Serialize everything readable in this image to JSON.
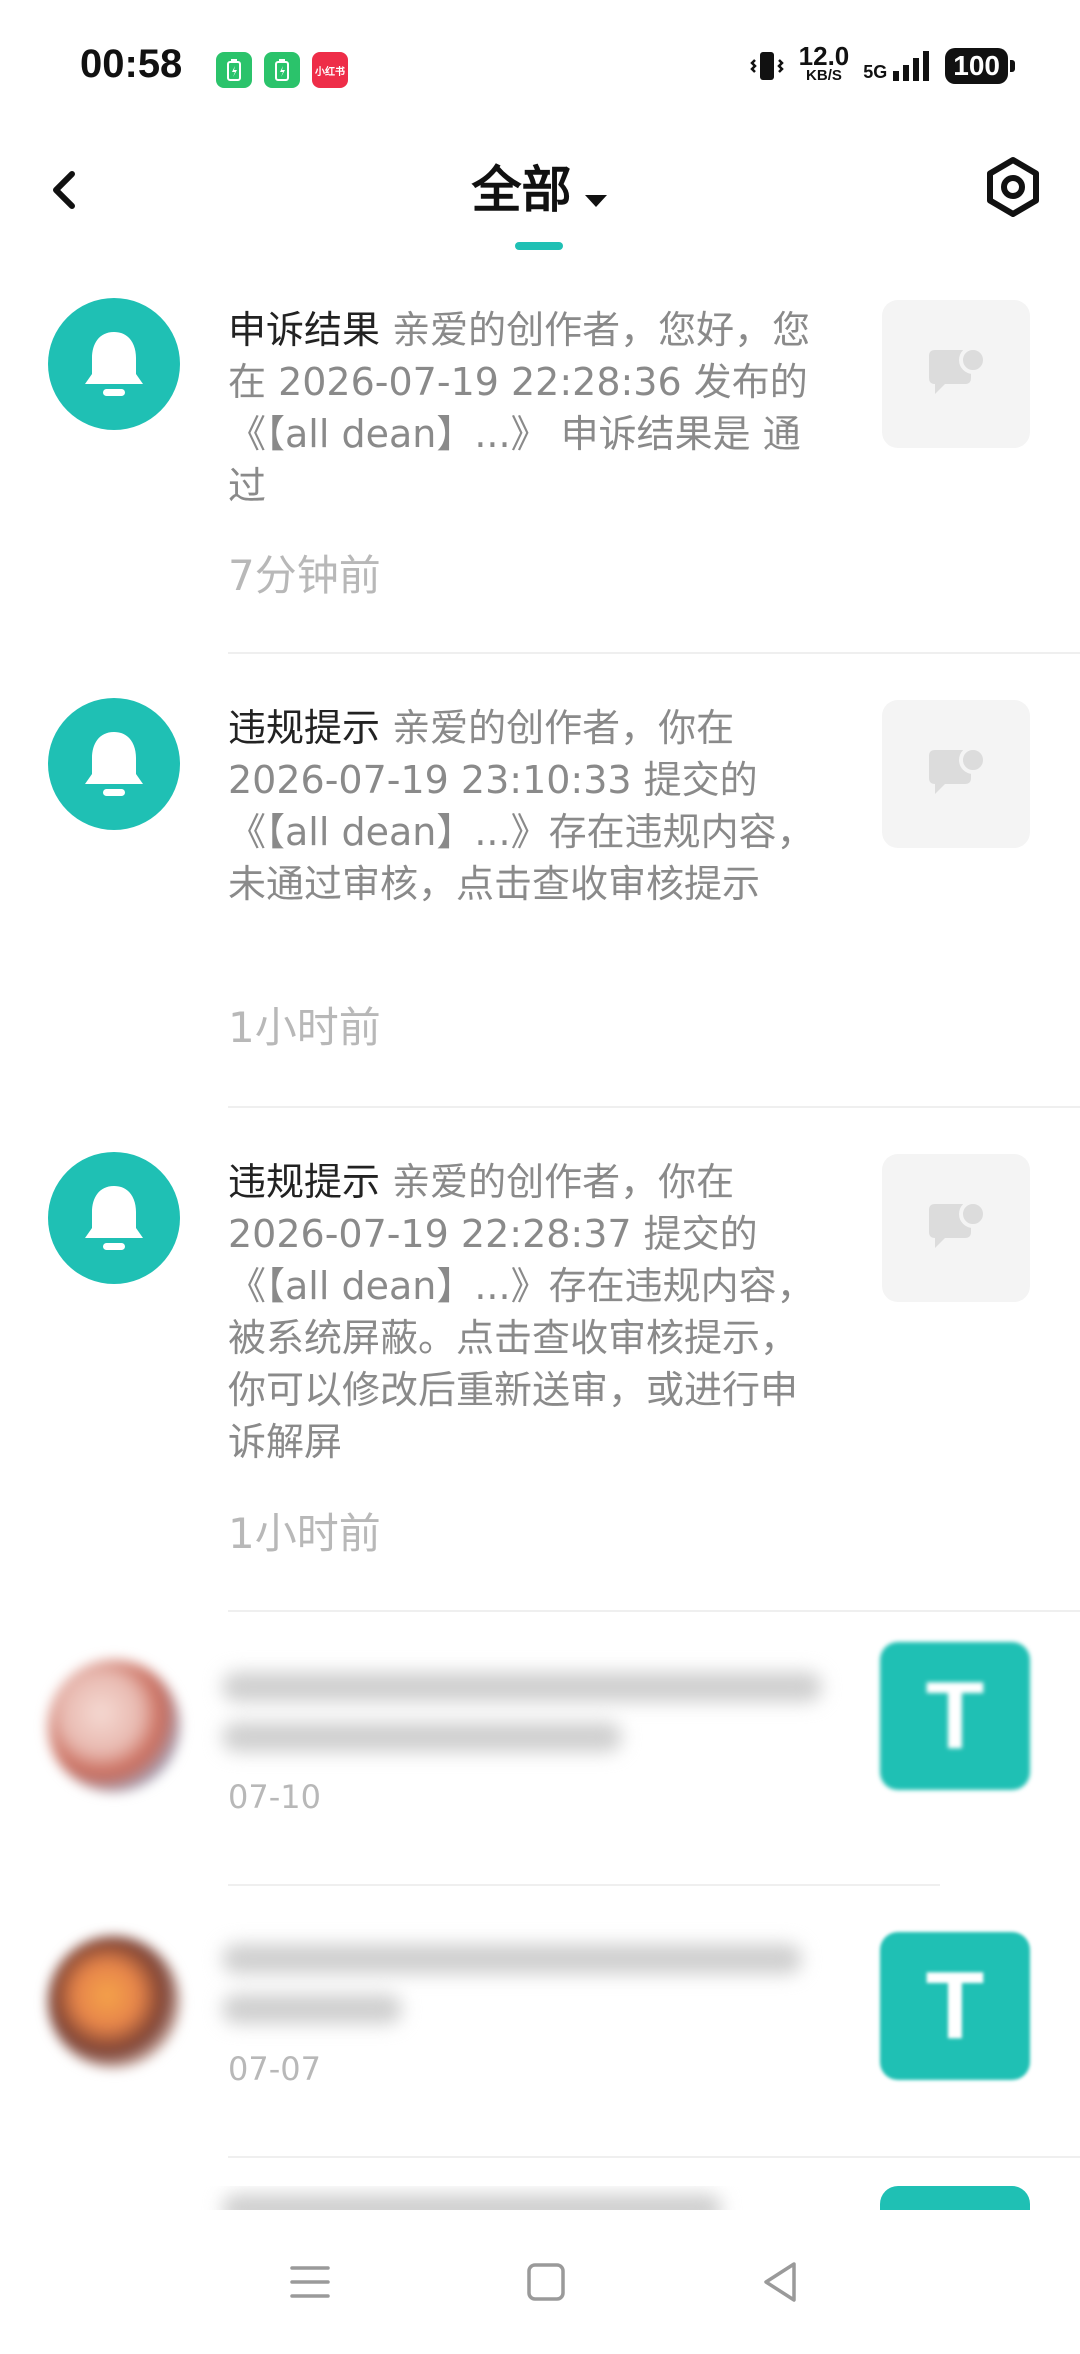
{
  "status_bar": {
    "time": "00:58",
    "app_icons": [
      {
        "name": "battery-app-icon",
        "color": "#2bc36b",
        "label": "▯"
      },
      {
        "name": "battery-app-icon-2",
        "color": "#2bc36b",
        "label": "▯"
      },
      {
        "name": "xiaohongshu-icon",
        "color": "#ee2d48",
        "label": "小红书"
      }
    ],
    "net_speed": "12.0",
    "net_unit": "KB/S",
    "network": "5G",
    "battery": "100"
  },
  "header": {
    "title": "全部",
    "accent": "#1fc0b4"
  },
  "notifications": [
    {
      "kind": "申诉结果",
      "text": " 亲爱的创作者，您好，您在 2026-07-19 22:28:36 发布的《【all dean】...》 申诉结果是 通过",
      "time": "7分钟前"
    },
    {
      "kind": "违规提示",
      "text": " 亲爱的创作者，你在 2026-07-19 23:10:33 提交的《【all dean】...》存在违规内容，未通过审核，点击查收审核提示",
      "time": "1小时前"
    },
    {
      "kind": "违规提示",
      "text": " 亲爱的创作者，你在 2026-07-19 22:28:37 提交的《【all dean】...》存在违规内容，被系统屏蔽。点击查收审核提示，你可以修改后重新送审，或进行申诉解屏",
      "time": "1小时前"
    }
  ],
  "blurred_items": [
    {
      "date": "07-10",
      "thumb_letter": "T"
    },
    {
      "date": "07-07",
      "thumb_letter": "T"
    }
  ]
}
